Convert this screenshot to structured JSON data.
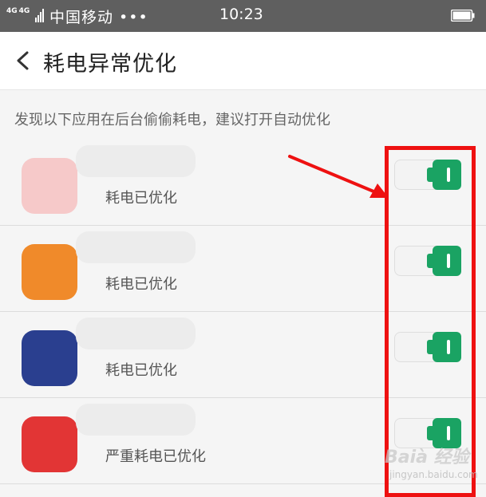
{
  "status_bar": {
    "network_1": "4G",
    "network_2": "4G",
    "carrier": "中国移动 •••",
    "time": "10:23"
  },
  "header": {
    "back_icon": "chevron-left-icon",
    "title": "耗电异常优化"
  },
  "hint": "发现以下应用在后台偷偷耗电，建议打开自动优化",
  "apps": [
    {
      "status": "耗电已优化",
      "toggle_on": true,
      "icon_color": "#f6c9c9"
    },
    {
      "status": "耗电已优化",
      "toggle_on": true,
      "icon_color": "#f08a2a"
    },
    {
      "status": "耗电已优化",
      "toggle_on": true,
      "icon_color": "#2a3f8f"
    },
    {
      "status": "严重耗电已优化",
      "toggle_on": true,
      "icon_color": "#e23535"
    }
  ],
  "colors": {
    "toggle_on": "#1aa363",
    "highlight": "#ee1111",
    "status_bar": "#5f5f5f"
  },
  "watermark": {
    "brand": "Baià 经验",
    "url": "jingyan.baidu.com"
  }
}
